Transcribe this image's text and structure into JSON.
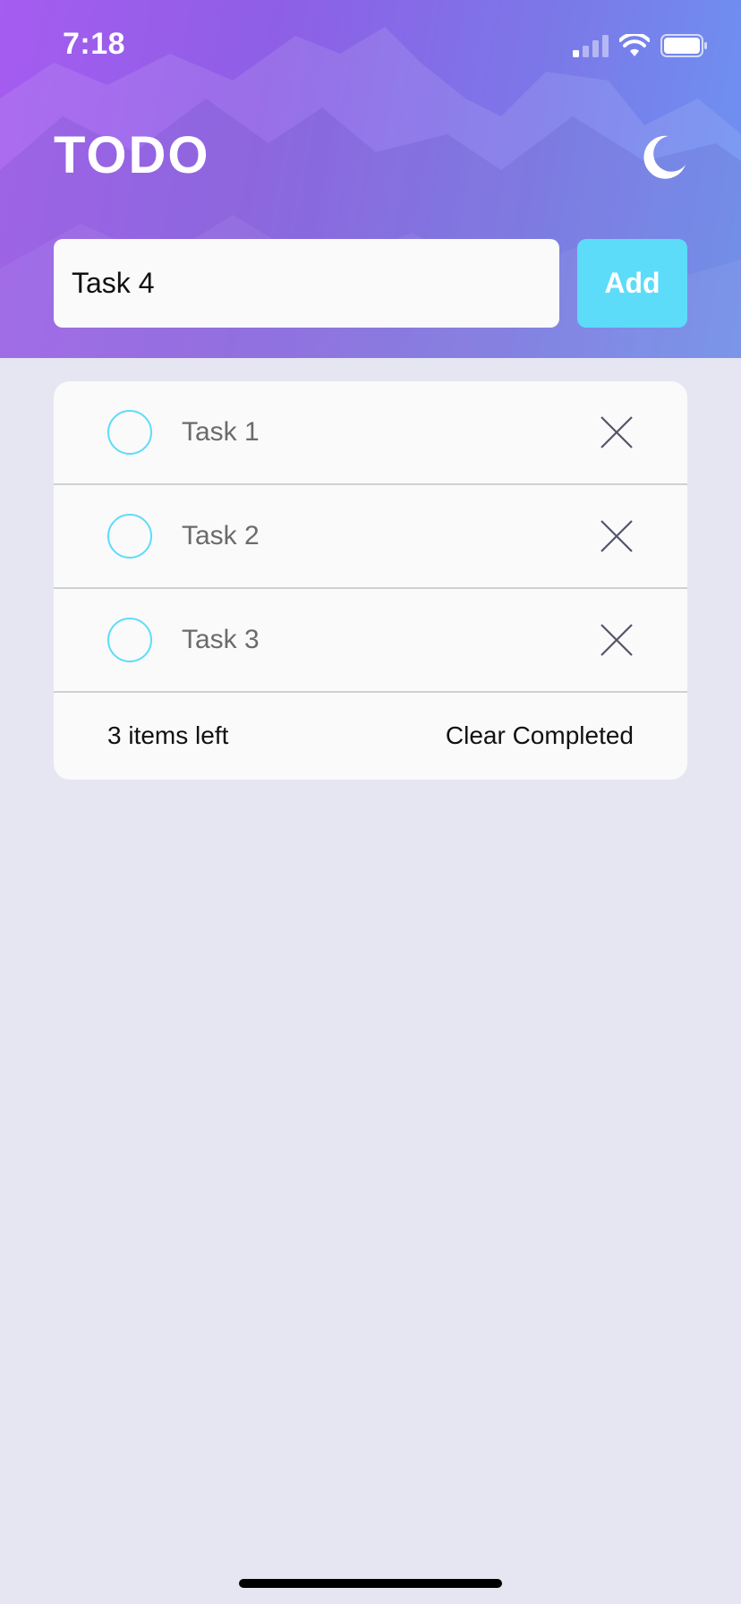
{
  "status_bar": {
    "time": "7:18"
  },
  "header": {
    "title": "TODO",
    "theme_icon": "moon-icon"
  },
  "input": {
    "value": "Task 4",
    "placeholder": ""
  },
  "add_button": {
    "label": "Add"
  },
  "tasks": [
    {
      "label": "Task 1",
      "completed": false
    },
    {
      "label": "Task 2",
      "completed": false
    },
    {
      "label": "Task 3",
      "completed": false
    }
  ],
  "footer": {
    "items_left": "3 items left",
    "clear_label": "Clear Completed"
  },
  "colors": {
    "accent": "#5ddcfa",
    "background": "#e6e6f2",
    "card": "#fafafa",
    "header_start": "#a55cf0",
    "header_end": "#6c94f2"
  }
}
